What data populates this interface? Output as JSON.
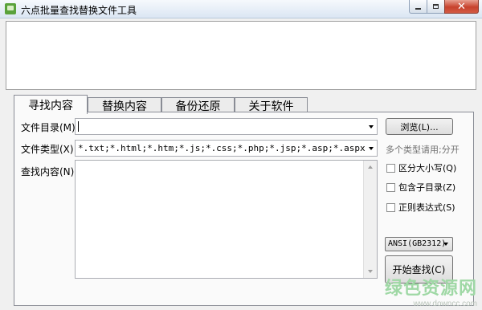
{
  "window": {
    "title": "六点批量查找替换文件工具",
    "close_glyph": "✕"
  },
  "tabs": [
    {
      "label": "寻找内容",
      "active": true
    },
    {
      "label": "替换内容",
      "active": false
    },
    {
      "label": "备份还原",
      "active": false
    },
    {
      "label": "关于软件",
      "active": false
    }
  ],
  "form": {
    "dir_label": "文件目录(M)",
    "dir_value": "",
    "browse_label": "浏览(L)...",
    "type_label": "文件类型(X)",
    "type_value": "*.txt;*.html;*.htm;*.js;*.css;*.php;*.jsp;*.asp;*.aspx",
    "type_hint": "多个类型请用;分开",
    "find_label": "查找内容(N)",
    "find_value": ""
  },
  "options": [
    {
      "label": "区分大小写(Q)",
      "checked": false
    },
    {
      "label": "包含子目录(Z)",
      "checked": false
    },
    {
      "label": "正则表达式(S)",
      "checked": false
    }
  ],
  "encoding": {
    "selected": "ANSI(GB2312)"
  },
  "start_button": "开始查找(C)",
  "watermark": {
    "main": "绿色资源网",
    "sub": "www.downcc.com"
  }
}
